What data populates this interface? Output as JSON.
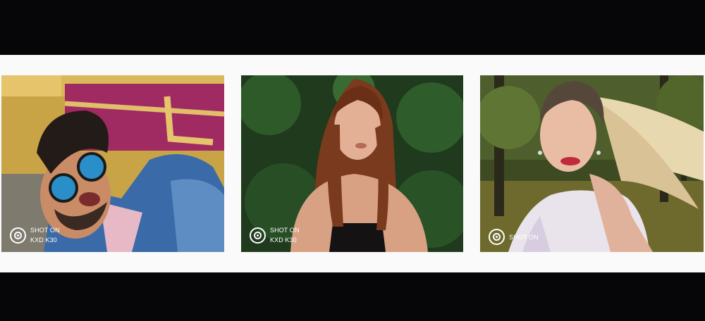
{
  "gallery": {
    "photos": [
      {
        "subject": "man in blue mirrored round sunglasses and denim jacket against graffiti wall",
        "watermark": {
          "line1": "SHOT ON",
          "line2": "KXD K30",
          "logo_icon": "camera-lens-icon"
        }
      },
      {
        "subject": "woman with long auburn hair in front of green foliage",
        "watermark": {
          "line1": "SHOT ON",
          "line2": "KXD K30",
          "logo_icon": "camera-lens-icon"
        }
      },
      {
        "subject": "blonde woman with flying ponytail in forest",
        "watermark": {
          "line1": "SHOT ON",
          "line2": "",
          "logo_icon": "camera-lens-icon"
        }
      }
    ]
  },
  "colors": {
    "letterbox": "#060608",
    "band": "#fafafa",
    "watermark_text": "#ffffff"
  }
}
